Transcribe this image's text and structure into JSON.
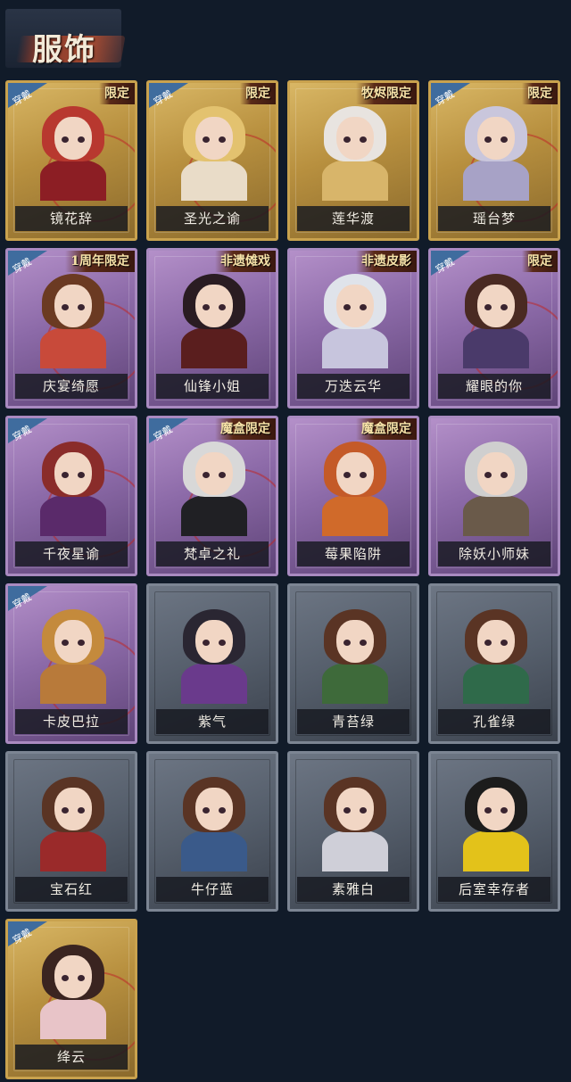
{
  "header": {
    "title": "服饰"
  },
  "labels": {
    "wear": "穿戴"
  },
  "cards": [
    {
      "name": "镜花辞",
      "tag": "限定",
      "worn": true
    },
    {
      "name": "圣光之谕",
      "tag": "限定",
      "worn": true
    },
    {
      "name": "莲华渡",
      "tag": "牧烬限定",
      "worn": false
    },
    {
      "name": "瑶台梦",
      "tag": "限定",
      "worn": true
    },
    {
      "name": "庆宴绮愿",
      "tag": "1周年限定",
      "worn": true
    },
    {
      "name": "仙锋小姐",
      "tag": "非遗傩戏",
      "worn": false
    },
    {
      "name": "万迭云华",
      "tag": "非遗皮影",
      "worn": false
    },
    {
      "name": "耀眼的你",
      "tag": "限定",
      "worn": true
    },
    {
      "name": "千夜星谕",
      "tag": "",
      "worn": true
    },
    {
      "name": "梵卓之礼",
      "tag": "魔盒限定",
      "worn": true
    },
    {
      "name": "莓果陷阱",
      "tag": "魔盒限定",
      "worn": false
    },
    {
      "name": "除妖小师妹",
      "tag": "",
      "worn": false
    },
    {
      "name": "卡皮巴拉",
      "tag": "",
      "worn": true
    },
    {
      "name": "紫气",
      "tag": "",
      "worn": false
    },
    {
      "name": "青苔绿",
      "tag": "",
      "worn": false
    },
    {
      "name": "孔雀绿",
      "tag": "",
      "worn": false
    },
    {
      "name": "宝石红",
      "tag": "",
      "worn": false
    },
    {
      "name": "牛仔蓝",
      "tag": "",
      "worn": false
    },
    {
      "name": "素雅白",
      "tag": "",
      "worn": false
    },
    {
      "name": "后室幸存者",
      "tag": "",
      "worn": false
    },
    {
      "name": "绛云",
      "tag": "",
      "worn": true
    }
  ]
}
